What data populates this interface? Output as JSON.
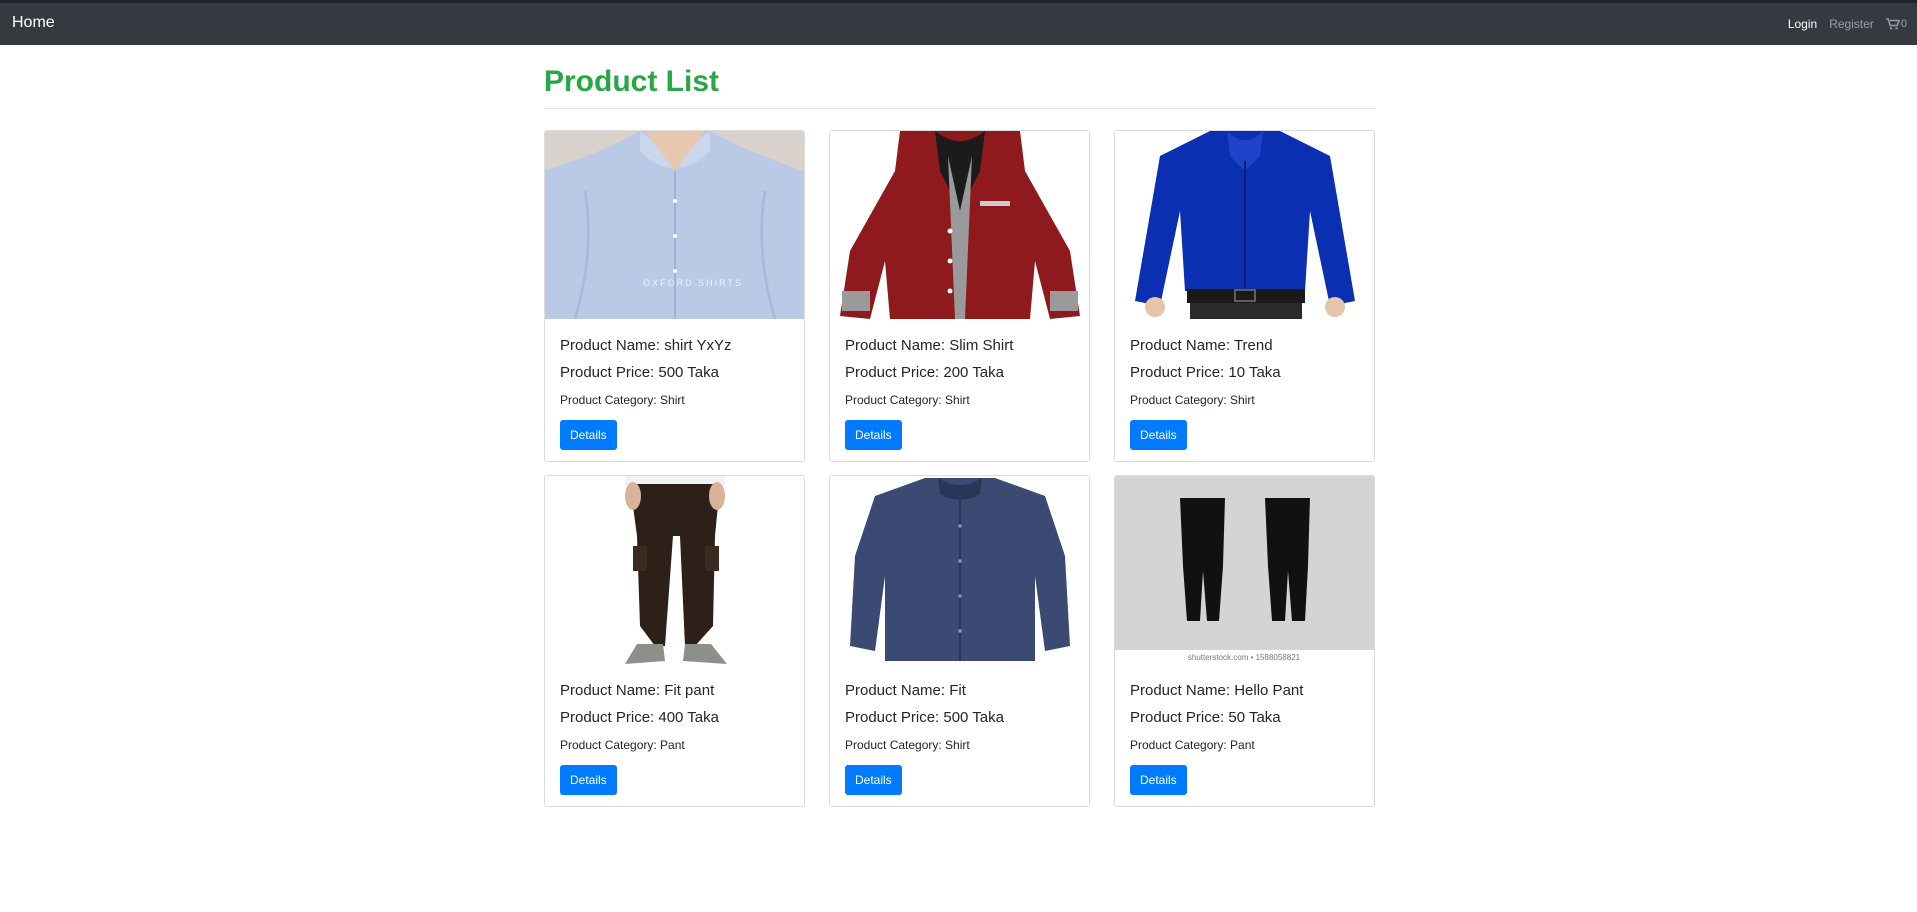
{
  "nav": {
    "brand": "Home",
    "login": "Login",
    "register": "Register",
    "cart_count": "0"
  },
  "page": {
    "title": "Product List"
  },
  "products": [
    {
      "name": "Product Name: shirt YxYz",
      "price": "Product Price: 500 Taka",
      "category": "Product Category: Shirt",
      "button": "Details",
      "image_text": "OXFORD SHIRTS"
    },
    {
      "name": "Product Name: Slim Shirt",
      "price": "Product Price: 200 Taka",
      "category": "Product Category: Shirt",
      "button": "Details"
    },
    {
      "name": "Product Name: Trend",
      "price": "Product Price: 10 Taka",
      "category": "Product Category: Shirt",
      "button": "Details"
    },
    {
      "name": "Product Name: Fit pant",
      "price": "Product Price: 400 Taka",
      "category": "Product Category: Pant",
      "button": "Details"
    },
    {
      "name": "Product Name: Fit",
      "price": "Product Price: 500 Taka",
      "category": "Product Category: Shirt",
      "button": "Details"
    },
    {
      "name": "Product Name: Hello Pant",
      "price": "Product Price: 50 Taka",
      "category": "Product Category: Pant",
      "button": "Details",
      "image_text": "shutterstock.com • 1588058821"
    }
  ],
  "colors": {
    "navbar": "#343a40",
    "title": "#28a745",
    "button": "#007bff"
  }
}
